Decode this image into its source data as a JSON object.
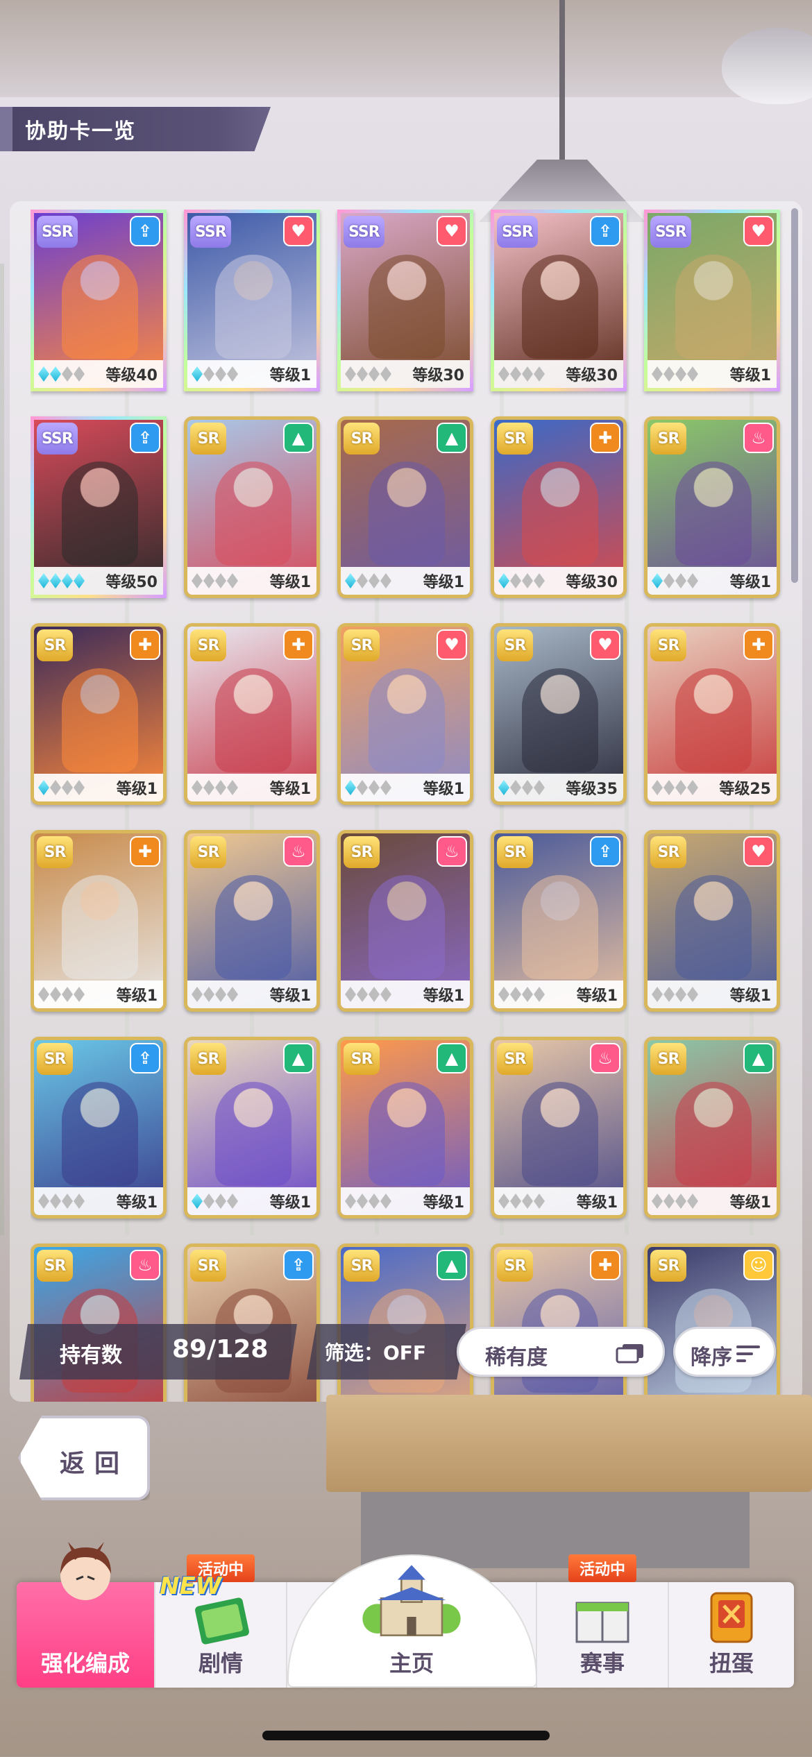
{
  "header": {
    "title": "协助卡一览"
  },
  "cards": [
    {
      "rarity": "SSR",
      "type": "speed",
      "type_color": "#2e9bf0",
      "gems": 2,
      "level": "等级40",
      "art": [
        "#6b3fd0",
        "#ff8a3a"
      ]
    },
    {
      "rarity": "SSR",
      "type": "wisdom",
      "type_color": "#ff5a6e",
      "gems": 1,
      "level": "等级1",
      "art": [
        "#3d5aa8",
        "#c8c8e0"
      ]
    },
    {
      "rarity": "SSR",
      "type": "wisdom",
      "type_color": "#ff5a6e",
      "gems": 0,
      "level": "等级30",
      "art": [
        "#d9a8c8",
        "#7a4a2a"
      ]
    },
    {
      "rarity": "SSR",
      "type": "speed",
      "type_color": "#2e9bf0",
      "gems": 0,
      "level": "等级30",
      "art": [
        "#f4c0c8",
        "#5a2a1a"
      ]
    },
    {
      "rarity": "SSR",
      "type": "wisdom",
      "type_color": "#ff5a6e",
      "gems": 0,
      "level": "等级1",
      "art": [
        "#7aa868",
        "#c8a86a"
      ]
    },
    {
      "rarity": "SSR",
      "type": "speed",
      "type_color": "#2e9bf0",
      "gems": 4,
      "level": "等级50",
      "art": [
        "#d84a5a",
        "#2a2a2a"
      ]
    },
    {
      "rarity": "SR",
      "type": "power",
      "type_color": "#22b87a",
      "gems": 0,
      "level": "等级1",
      "art": [
        "#a8c8e8",
        "#d84a5a"
      ]
    },
    {
      "rarity": "SR",
      "type": "power",
      "type_color": "#22b87a",
      "gems": 1,
      "level": "等级1",
      "art": [
        "#a86a4a",
        "#6a5aa8"
      ]
    },
    {
      "rarity": "SR",
      "type": "stamina",
      "type_color": "#f08a1e",
      "gems": 1,
      "level": "等级30",
      "art": [
        "#3a6ac8",
        "#d84a4a"
      ]
    },
    {
      "rarity": "SR",
      "type": "fire",
      "type_color": "#ff5a8a",
      "gems": 1,
      "level": "等级1",
      "art": [
        "#8ac868",
        "#6a4a9a"
      ]
    },
    {
      "rarity": "SR",
      "type": "stamina",
      "type_color": "#f08a1e",
      "gems": 1,
      "level": "等级1",
      "art": [
        "#3a2a5a",
        "#ff8a3a"
      ]
    },
    {
      "rarity": "SR",
      "type": "stamina",
      "type_color": "#f08a1e",
      "gems": 0,
      "level": "等级1",
      "art": [
        "#e8e8f0",
        "#c83a4a"
      ]
    },
    {
      "rarity": "SR",
      "type": "wisdom",
      "type_color": "#ff5a6e",
      "gems": 1,
      "level": "等级1",
      "art": [
        "#f0a060",
        "#8a8ac8"
      ]
    },
    {
      "rarity": "SR",
      "type": "wisdom",
      "type_color": "#ff5a6e",
      "gems": 1,
      "level": "等级35",
      "art": [
        "#a8b8c8",
        "#2a2a3a"
      ]
    },
    {
      "rarity": "SR",
      "type": "stamina",
      "type_color": "#f08a1e",
      "gems": 0,
      "level": "等级25",
      "art": [
        "#e8d0c0",
        "#c83a3a"
      ]
    },
    {
      "rarity": "SR",
      "type": "stamina",
      "type_color": "#f08a1e",
      "gems": 0,
      "level": "等级1",
      "art": [
        "#c88a4a",
        "#e8e8e8"
      ]
    },
    {
      "rarity": "SR",
      "type": "fire",
      "type_color": "#ff5a8a",
      "gems": 0,
      "level": "等级1",
      "art": [
        "#f0c890",
        "#4a5aa8"
      ]
    },
    {
      "rarity": "SR",
      "type": "fire",
      "type_color": "#ff5a8a",
      "gems": 0,
      "level": "等级1",
      "art": [
        "#6a4a3a",
        "#8a6ac8"
      ]
    },
    {
      "rarity": "SR",
      "type": "speed",
      "type_color": "#2e9bf0",
      "gems": 0,
      "level": "等级1",
      "art": [
        "#4a5a9a",
        "#e8c0a0"
      ]
    },
    {
      "rarity": "SR",
      "type": "wisdom",
      "type_color": "#ff5a6e",
      "gems": 0,
      "level": "等级1",
      "art": [
        "#c8a870",
        "#4a5a9a"
      ]
    },
    {
      "rarity": "SR",
      "type": "speed",
      "type_color": "#2e9bf0",
      "gems": 0,
      "level": "等级1",
      "art": [
        "#6ac8e8",
        "#3a3a8a"
      ]
    },
    {
      "rarity": "SR",
      "type": "power",
      "type_color": "#22b87a",
      "gems": 1,
      "level": "等级1",
      "art": [
        "#e8d8c0",
        "#6a4ac8"
      ]
    },
    {
      "rarity": "SR",
      "type": "power",
      "type_color": "#22b87a",
      "gems": 0,
      "level": "等级1",
      "art": [
        "#ff9a4a",
        "#6a5ac8"
      ]
    },
    {
      "rarity": "SR",
      "type": "fire",
      "type_color": "#ff5a8a",
      "gems": 0,
      "level": "等级1",
      "art": [
        "#e8c8a8",
        "#4a4a8a"
      ]
    },
    {
      "rarity": "SR",
      "type": "power",
      "type_color": "#22b87a",
      "gems": 0,
      "level": "等级1",
      "art": [
        "#8ac8a8",
        "#c83a4a"
      ]
    },
    {
      "rarity": "SR",
      "type": "fire",
      "type_color": "#ff5a8a",
      "gems": 0,
      "level": "",
      "art": [
        "#3aa8e8",
        "#c83a3a"
      ]
    },
    {
      "rarity": "SR",
      "type": "speed",
      "type_color": "#2e9bf0",
      "gems": 0,
      "level": "",
      "art": [
        "#e8d0b0",
        "#8a4a3a"
      ]
    },
    {
      "rarity": "SR",
      "type": "power",
      "type_color": "#22b87a",
      "gems": 0,
      "level": "",
      "art": [
        "#4a6ac8",
        "#e8a87a"
      ]
    },
    {
      "rarity": "SR",
      "type": "stamina",
      "type_color": "#f08a1e",
      "gems": 0,
      "level": "",
      "art": [
        "#e8c8a8",
        "#5a5aa8"
      ]
    },
    {
      "rarity": "SR",
      "type": "friend",
      "type_color": "#ffc83a",
      "gems": 0,
      "level": "",
      "art": [
        "#3a3a6a",
        "#c8d8e8"
      ]
    }
  ],
  "footer": {
    "own_label": "持有数",
    "own_count": "89/128",
    "filter_label": "筛选：OFF",
    "sort_label": "稀有度",
    "order_label": "降序",
    "back_label": "返回"
  },
  "nav": {
    "items": [
      {
        "label": "强化编成",
        "active": true
      },
      {
        "label": "剧情",
        "badge": "活动中",
        "new": "NEW"
      },
      {
        "label": "主页"
      },
      {
        "label": "赛事",
        "badge": "活动中"
      },
      {
        "label": "扭蛋"
      }
    ]
  }
}
